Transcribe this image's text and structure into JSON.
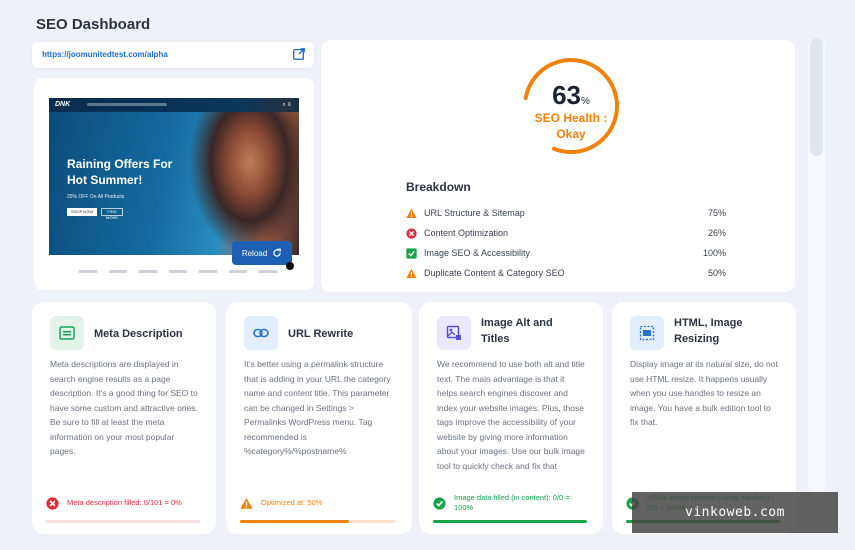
{
  "page": {
    "title": "SEO Dashboard"
  },
  "url_card": {
    "url": "https://joomunitedtest.com/alpha",
    "icon": "external-link-icon"
  },
  "preview": {
    "site_logo": "DNK",
    "site_nav_right": "⌕ ≡",
    "headline": "Raining Offers For Hot Summer!",
    "sub": "25% OFF On All Products",
    "btn_shop": "SHOP NOW",
    "btn_find": "FIND MORE",
    "reload_label": "Reload"
  },
  "health": {
    "score": "63",
    "pct_symbol": "%",
    "score_value": 63,
    "label": "SEO Health : Okay",
    "accent": "#f0820c",
    "breakdown_title": "Breakdown",
    "items": [
      {
        "label": "URL Structure & Sitemap",
        "value": "75%",
        "status": "warning"
      },
      {
        "label": "Content Optimization",
        "value": "26%",
        "status": "error"
      },
      {
        "label": "Image SEO & Accessibility",
        "value": "100%",
        "status": "success"
      },
      {
        "label": "Duplicate Content & Category SEO",
        "value": "50%",
        "status": "warning"
      }
    ]
  },
  "cards": [
    {
      "title": "Meta Description",
      "body": "Meta descriptions are displayed in search engine results as a page description. It’s a good thing for SEO to have some custom and attractive ones. Be sure to fill at least the meta information on your most popular pages.",
      "status_text": "Meta description filled: 0/101 = 0%",
      "status": "error",
      "progress": 0,
      "icon": "meta-description-icon"
    },
    {
      "title": "URL Rewrite",
      "body": "It’s better using a permalink structure that is adding in your URL the category name and content title. This parameter can be changed in Settings > Permalinks WordPress menu. Tag recommended is %category%/%postname%",
      "status_text": "Optimized at: 50%",
      "status": "warning",
      "progress": 0.7,
      "icon": "link-icon"
    },
    {
      "title": "Image Alt and Titles",
      "body": "We recommend to use both alt and title text. The main advantage is that it helps search engines discover and index your website images. Plus, those tags improve the accessibility of your website by giving more information about your images. Use our bulk image tool to quickly check and fix that",
      "status_text": "Image data filled (in content): 0/0 = 100%",
      "status": "success",
      "progress": 1,
      "icon": "image-alt-icon"
    },
    {
      "title": "HTML, Image Resizing",
      "body": "Display image at its natural size, do not use HTML resize. It happens usually when you use handles to resize an image. You have a bulk edition tool to fix that.",
      "status_text": "HTML image resized (using handles) : 0/0 = 100%",
      "status": "success",
      "progress": 1,
      "icon": "resize-icon"
    }
  ],
  "colors": {
    "warning": "#f0820c",
    "error": "#e02d3c",
    "success": "#17a34a",
    "link": "#1e6bd6"
  },
  "watermark": "vinkoweb.com"
}
